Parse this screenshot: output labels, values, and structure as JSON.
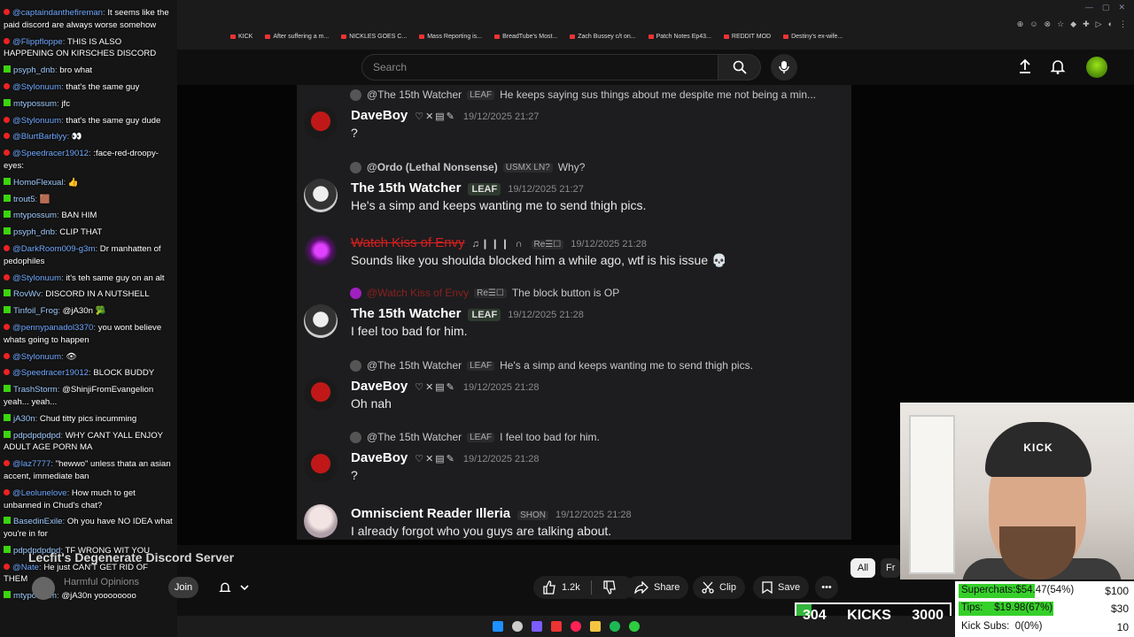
{
  "browser": {
    "bookmarks": [
      "KICK",
      "After suffering a m...",
      "NICKLES GOES C...",
      "Mass Reporting is...",
      "BreadTube's Most...",
      "Zach Bussey c/t on...",
      "Patch Notes Ep43...",
      "REDDIT MOD",
      "Destiny's ex-wife..."
    ]
  },
  "header": {
    "search_placeholder": "Search"
  },
  "discord": {
    "messages": [
      {
        "reply_user": "@The 15th Watcher",
        "reply_badge": "LEAF",
        "reply_text": "He keeps saying sus things about me despite me not being a min...",
        "user": "DaveBoy",
        "icons": "♡✕▤✎",
        "ts": "19/12/2025 21:27",
        "text": "?"
      },
      {
        "reply_user": "@Ordo (Lethal Nonsense)",
        "reply_badge": "USMX  LN?",
        "reply_text": "Why?",
        "user": "The 15th Watcher",
        "badge": "LEAF",
        "ts": "19/12/2025 21:27",
        "text": "He's a simp and keeps wanting me to send thigh pics."
      },
      {
        "user": "Watch Kiss of Envy",
        "icons": "♫❙❙❙ ∩",
        "badge": "Re☰☐",
        "ts": "19/12/2025 21:28",
        "text": "Sounds like you shoulda blocked him a while ago, wtf is his issue 💀"
      },
      {
        "reply_user": "@Watch Kiss of Envy",
        "reply_badge": "Re☰☐",
        "reply_text": "The block button is OP",
        "user": "The 15th Watcher",
        "badge": "LEAF",
        "ts": "19/12/2025 21:28",
        "text": "I feel too bad for him."
      },
      {
        "reply_user": "@The 15th Watcher",
        "reply_badge": "LEAF",
        "reply_text": "He's a simp and keeps wanting me to send thigh pics.",
        "user": "DaveBoy",
        "icons": "♡✕▤✎",
        "ts": "19/12/2025 21:28",
        "text": "Oh nah"
      },
      {
        "reply_user": "@The 15th Watcher",
        "reply_badge": "LEAF",
        "reply_text": "I feel too bad for him.",
        "user": "DaveBoy",
        "icons": "♡✕▤✎",
        "ts": "19/12/2025 21:28",
        "text": "?"
      },
      {
        "user": "Omniscient Reader Illeria",
        "badge": "SHON",
        "ts": "19/12/2025 21:28",
        "text": "I already forgot who you guys are talking about."
      }
    ]
  },
  "chat": [
    {
      "p": "yt",
      "n": "@captaindanthefireman",
      "t": "It seems like the paid discord are always worse somehow"
    },
    {
      "p": "yt",
      "n": "@Flippfloppe",
      "t": "THIS IS ALSO HAPPENING ON KIRSCHES DISCORD"
    },
    {
      "p": "k",
      "n": "psyph_dnb",
      "t": "bro what"
    },
    {
      "p": "yt",
      "n": "@Stylonuum",
      "t": "that's the same guy"
    },
    {
      "p": "k",
      "n": "mtypossum",
      "t": "jfc"
    },
    {
      "p": "yt",
      "n": "@Stylonuum",
      "t": "that's the same guy dude"
    },
    {
      "p": "yt",
      "n": "@BlurtBarblyy",
      "t": "👀"
    },
    {
      "p": "yt",
      "n": "@Speedracer19012",
      "t": ":face-red-droopy-eyes:"
    },
    {
      "p": "k",
      "n": "HomoFlexual",
      "t": "👍"
    },
    {
      "p": "k",
      "n": "trout5",
      "t": "🟫"
    },
    {
      "p": "k",
      "n": "mtypossum",
      "t": "BAN HIM"
    },
    {
      "p": "k",
      "n": "psyph_dnb",
      "t": "CLIP THAT"
    },
    {
      "p": "yt",
      "n": "@DarkRoom009-g3m",
      "t": "Dr manhatten of pedophiles"
    },
    {
      "p": "yt",
      "n": "@Stylonuum",
      "t": "it's teh same guy on an alt"
    },
    {
      "p": "k",
      "n": "RovWv",
      "t": "DISCORD IN A NUTSHELL"
    },
    {
      "p": "k",
      "n": "Tinfoil_Frog",
      "t": "@jA30n 🥦"
    },
    {
      "p": "yt",
      "n": "@pennypanadol3370",
      "t": "you wont believe whats going to happen"
    },
    {
      "p": "yt",
      "n": "@Stylonuum",
      "t": "👁"
    },
    {
      "p": "yt",
      "n": "@Speedracer19012",
      "t": "BLOCK BUDDY"
    },
    {
      "p": "k",
      "n": "TrashStorm",
      "t": "@ShinjiFromEvangelion yeah... yeah..."
    },
    {
      "p": "k",
      "n": "jA30n",
      "t": "Chud titty pics incumming"
    },
    {
      "p": "k",
      "n": "pdpdpdpdpd",
      "t": "WHY CANT YALL ENJOY ADULT AGE PORN MA"
    },
    {
      "p": "yt",
      "n": "@laz7777",
      "t": "\"hewwo\" unless thata an asian accent, immediate ban"
    },
    {
      "p": "yt",
      "n": "@Leolunelove",
      "t": "How much to get unbanned in Chud's chat?"
    },
    {
      "p": "k",
      "n": "BasedinExile",
      "t": "Oh you have NO IDEA what you're in for"
    },
    {
      "p": "k",
      "n": "pdpdpdpdpd",
      "t": "TF WRONG WIT YOU"
    },
    {
      "p": "yt",
      "n": "@Nate",
      "t": "He just CAN'T GET RID OF THEM"
    },
    {
      "p": "k",
      "n": "mtypossum",
      "t": "@jA30n yoooooooo"
    }
  ],
  "video": {
    "title": "Lecfit's Degenerate Discord Server",
    "channel": "Harmful Opinions",
    "join_label": "Join",
    "likes": "1.2k",
    "share_label": "Share",
    "clip_label": "Clip",
    "save_label": "Save"
  },
  "chips": {
    "all": "All",
    "next": "Fr"
  },
  "kick_goal": {
    "current": "304",
    "label": "KICKS",
    "target": "3000",
    "progress": 0.101
  },
  "superchats": [
    {
      "label": "Superchats:",
      "value": "$54.47(54%)",
      "goal": "$100",
      "progress": 0.54
    },
    {
      "label": "Tips:",
      "value": "$19.98(67%)",
      "goal": "$30",
      "progress": 0.67
    },
    {
      "label": "Kick Subs:",
      "value": "0(0%)",
      "goal": "10",
      "progress": 0.0
    }
  ],
  "colors": {
    "kick_green": "#32b53b",
    "yt_red": "#e22222",
    "sc_green": "#36d02a"
  }
}
